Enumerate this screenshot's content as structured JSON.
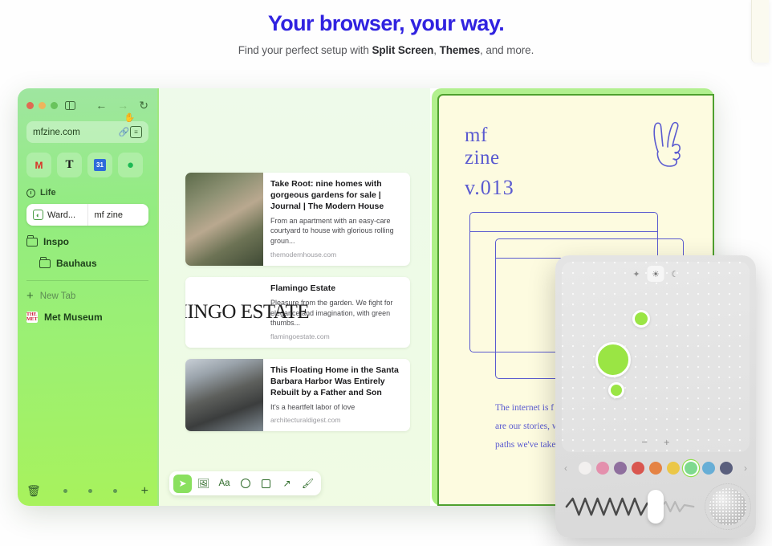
{
  "hero": {
    "title": "Your browser, your way.",
    "sub_pre": "Find your perfect setup with ",
    "sub_b1": "Split Screen",
    "sub_mid": ", ",
    "sub_b2": "Themes",
    "sub_post": ", and more."
  },
  "sidebar": {
    "url": "mfzine.com",
    "apps": [
      {
        "name": "gmail-app-icon",
        "glyph": "M"
      },
      {
        "name": "nyt-app-icon",
        "glyph": "T"
      },
      {
        "name": "calendar-app-icon",
        "glyph": "31"
      },
      {
        "name": "spotify-app-icon",
        "glyph": "●"
      }
    ],
    "section_label": "Life",
    "tabs": [
      {
        "label": "Ward...",
        "icon": "wardrobe-icon"
      },
      {
        "label": "mf zine",
        "icon": "peace-hand-icon"
      }
    ],
    "folders": [
      {
        "label": "Inspo"
      },
      {
        "label": "Bauhaus"
      }
    ],
    "new_tab_label": "New Tab",
    "bookmark_label": "Met Museum",
    "met_glyph": "THE MET"
  },
  "reader": {
    "cards": [
      {
        "title": "Take Root: nine homes with gorgeous gardens for sale | Journal | The Modern House",
        "desc": "From an apartment with an easy-care courtyard to house with glorious rolling groun...",
        "source": "themodernhouse.com",
        "thumb": "house-garden-photo"
      },
      {
        "title": "Flamingo Estate",
        "desc": "Pleasure from the garden. We fight for elegance and imagination, with green thumbs...",
        "source": "flamingoestate.com",
        "thumb": "flamingo-estate-logo",
        "thumb_text": "FLAMINGO ESTATE"
      },
      {
        "title": "This Floating Home in the Santa Barbara Harbor Was Entirely Rebuilt by a Father and Son",
        "desc": "It's a heartfelt labor of love",
        "source": "architecturaldigest.com",
        "thumb": "floating-home-photo"
      }
    ],
    "tools": [
      {
        "name": "cursor-tool",
        "glyph": "➤",
        "active": true
      },
      {
        "name": "image-tool",
        "glyph": "Ὓc",
        "active": false
      },
      {
        "name": "text-tool",
        "glyph": "Aa",
        "active": false
      },
      {
        "name": "circle-tool",
        "glyph": "",
        "active": false
      },
      {
        "name": "square-tool",
        "glyph": "",
        "active": false
      },
      {
        "name": "arrow-tool",
        "glyph": "↗",
        "active": false
      },
      {
        "name": "brush-tool",
        "glyph": "✎",
        "active": false
      }
    ]
  },
  "zine": {
    "title_line1": "mf",
    "title_line2": "zine",
    "version": "v.013",
    "body_line1": "The internet is f",
    "body_line2": "are our stories, w",
    "body_line3": "paths we've take"
  },
  "control_panel": {
    "modes": [
      {
        "name": "sparkle-icon",
        "glyph": "✦",
        "active": false
      },
      {
        "name": "sun-icon",
        "glyph": "☀",
        "active": true
      },
      {
        "name": "moon-icon",
        "glyph": "☾",
        "active": false
      }
    ],
    "zoom_out": "−",
    "zoom_in": "+",
    "prev_arrow": "‹",
    "next_arrow": "›",
    "gradient_color": "#9ae544",
    "swatches": [
      {
        "name": "white-swatch",
        "color": "#f2f0ef",
        "selected": false
      },
      {
        "name": "pink-swatch",
        "color": "#e490ad",
        "selected": false
      },
      {
        "name": "purple-swatch",
        "color": "#8f6f9e",
        "selected": false
      },
      {
        "name": "red-swatch",
        "color": "#d9564f",
        "selected": false
      },
      {
        "name": "orange-swatch",
        "color": "#e58344",
        "selected": false
      },
      {
        "name": "yellow-swatch",
        "color": "#ebc748",
        "selected": false
      },
      {
        "name": "green-swatch",
        "color": "#7ed98f",
        "selected": true
      },
      {
        "name": "blue-swatch",
        "color": "#67aed6",
        "selected": false
      },
      {
        "name": "navy-swatch",
        "color": "#5a5f7d",
        "selected": false
      }
    ]
  }
}
